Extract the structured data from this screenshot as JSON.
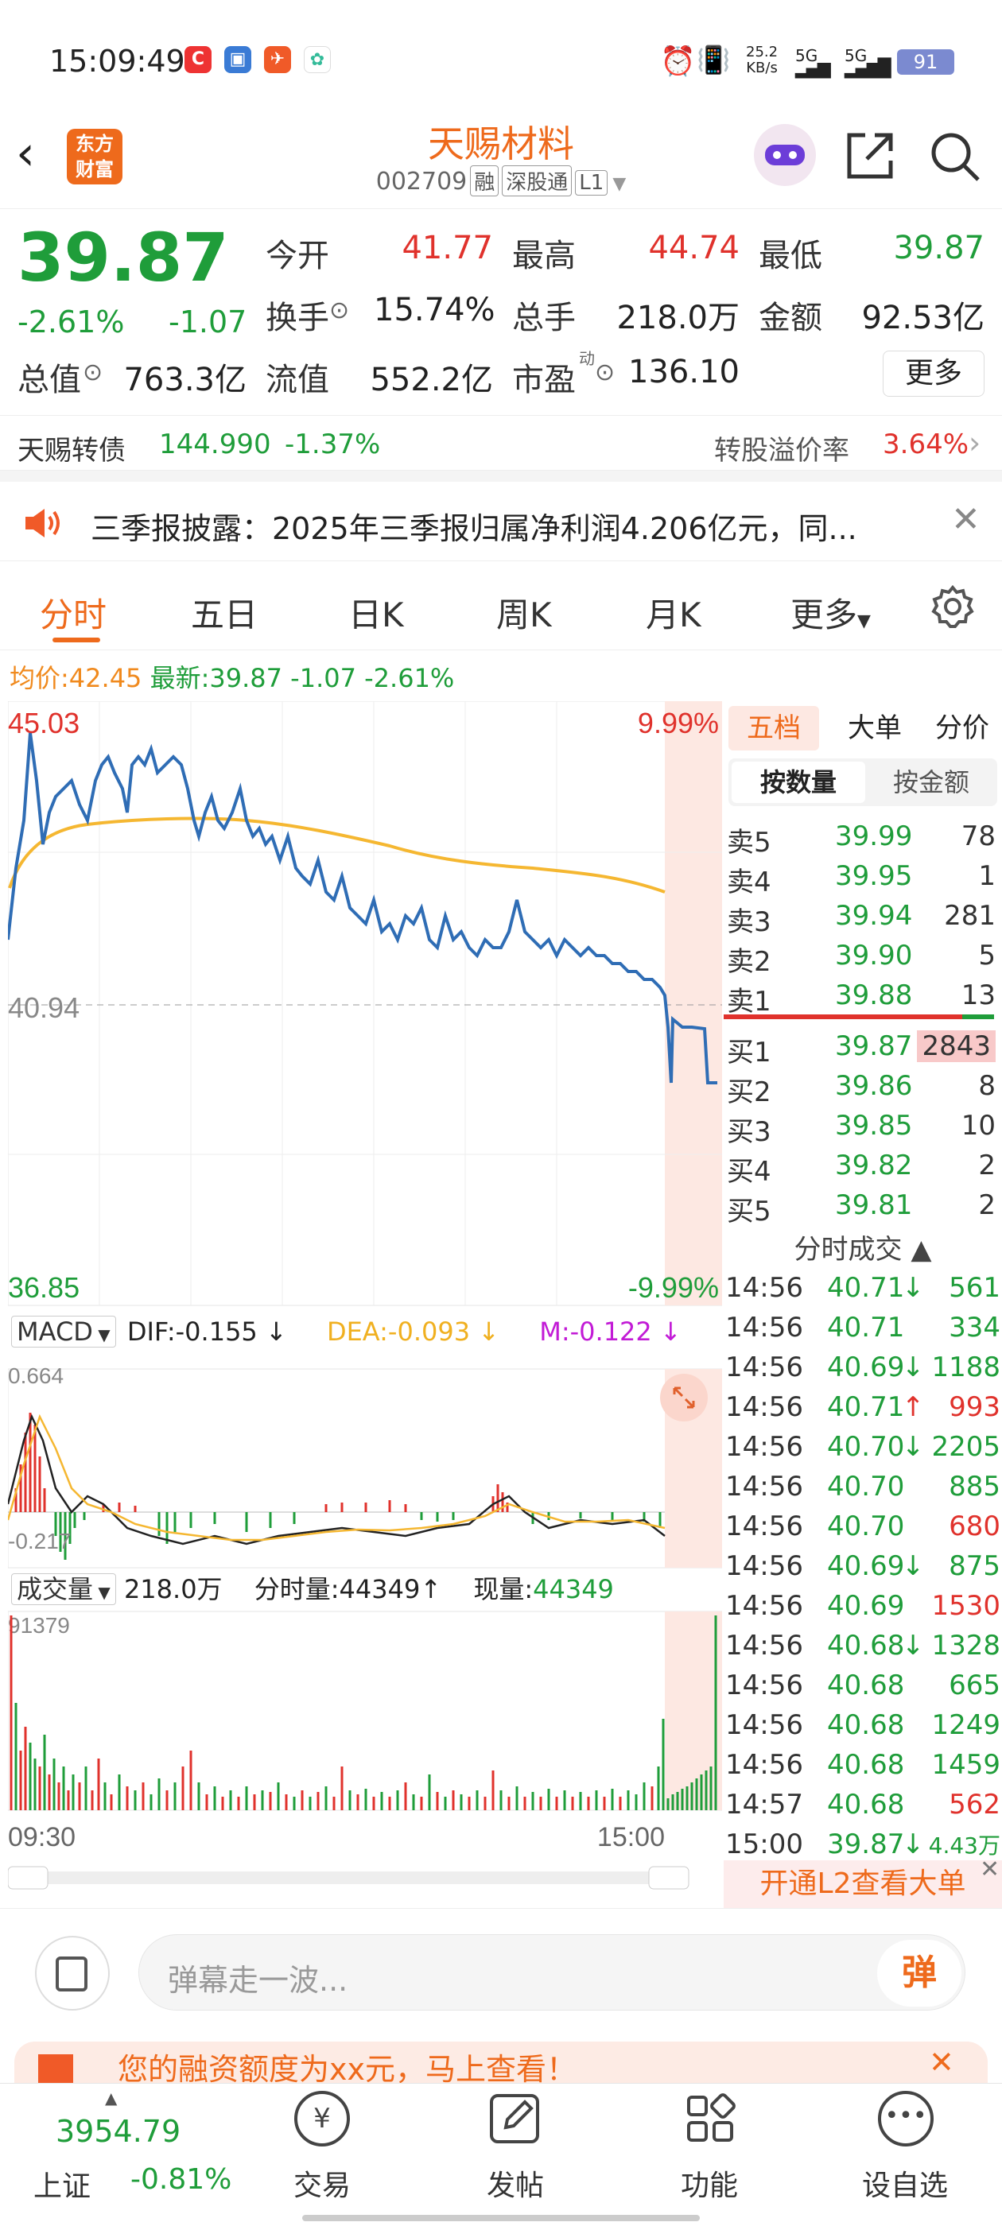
{
  "status_bar": {
    "time": "15:09:49",
    "net_speed": "25.2",
    "net_unit": "KB/s",
    "sig1": "5G",
    "sig2": "5G",
    "battery": "91"
  },
  "header": {
    "back_icon": "back-arrow-icon",
    "brand_line1": "东方",
    "brand_line2": "财富",
    "title": "天赐材料",
    "code": "002709",
    "tags": [
      "融",
      "深股通",
      "L1"
    ]
  },
  "quote": {
    "price": "39.87",
    "change_pct": "-2.61%",
    "change": "-1.07",
    "open_label": "今开",
    "open": "41.77",
    "high_label": "最高",
    "high": "44.74",
    "low_label": "最低",
    "low": "39.87",
    "turnover_label": "换手",
    "turnover": "15.74%",
    "volume_label": "总手",
    "volume": "218.0万",
    "amount_label": "金额",
    "amount": "92.53亿",
    "mktcap_label": "总值",
    "mktcap": "763.3亿",
    "float_label": "流值",
    "float": "552.2亿",
    "pe_label": "市盈",
    "pe_sup": "动",
    "pe": "136.10",
    "more_btn": "更多"
  },
  "bond": {
    "name": "天赐转债",
    "price": "144.990",
    "pct": "-1.37%",
    "premium_label": "转股溢价率",
    "premium": "3.64%"
  },
  "notice": {
    "text": "三季报披露：2025年三季报归属净利润4.206亿元，同..."
  },
  "tabs": [
    "分时",
    "五日",
    "日K",
    "周K",
    "月K",
    "更多"
  ],
  "avg_line": {
    "avg_label": "均价:",
    "avg": "42.45",
    "last_label": "最新:",
    "last": "39.87",
    "chg": "-1.07",
    "pct": "-2.61%"
  },
  "price_chart": {
    "top": "45.03",
    "mid": "40.94",
    "bottom": "36.85",
    "top_pct": "9.99%",
    "bottom_pct": "-9.99%"
  },
  "macd": {
    "label": "MACD",
    "dif": "DIF:-0.155",
    "dea": "DEA:-0.093",
    "m": "M:-0.122",
    "top": "0.664",
    "bottom": "-0.217"
  },
  "volume_panel": {
    "label": "成交量",
    "total": "218.0万",
    "fs_label": "分时量:",
    "fs": "44349",
    "cur_label": "现量:",
    "cur": "44349",
    "max": "91379"
  },
  "time_axis": {
    "start": "09:30",
    "end": "15:00"
  },
  "orderbook": {
    "tabs": [
      "五档",
      "大单",
      "分价"
    ],
    "modes": [
      "按数量",
      "按金额"
    ],
    "sells": [
      {
        "label": "卖5",
        "price": "39.99",
        "qty": "78"
      },
      {
        "label": "卖4",
        "price": "39.95",
        "qty": "1"
      },
      {
        "label": "卖3",
        "price": "39.94",
        "qty": "281"
      },
      {
        "label": "卖2",
        "price": "39.90",
        "qty": "5"
      },
      {
        "label": "卖1",
        "price": "39.88",
        "qty": "13"
      }
    ],
    "buys": [
      {
        "label": "买1",
        "price": "39.87",
        "qty": "2843"
      },
      {
        "label": "买2",
        "price": "39.86",
        "qty": "8"
      },
      {
        "label": "买3",
        "price": "39.85",
        "qty": "10"
      },
      {
        "label": "买4",
        "price": "39.82",
        "qty": "2"
      },
      {
        "label": "买5",
        "price": "39.81",
        "qty": "2"
      }
    ],
    "trades_title": "分时成交",
    "trades": [
      {
        "t": "14:56",
        "p": "40.71",
        "a": "↓",
        "q": "561",
        "c": "green"
      },
      {
        "t": "14:56",
        "p": "40.71",
        "a": "",
        "q": "334",
        "c": "green"
      },
      {
        "t": "14:56",
        "p": "40.69",
        "a": "↓",
        "q": "1188",
        "c": "green"
      },
      {
        "t": "14:56",
        "p": "40.71",
        "a": "↑",
        "q": "993",
        "c": "red"
      },
      {
        "t": "14:56",
        "p": "40.70",
        "a": "↓",
        "q": "2205",
        "c": "green"
      },
      {
        "t": "14:56",
        "p": "40.70",
        "a": "",
        "q": "885",
        "c": "green"
      },
      {
        "t": "14:56",
        "p": "40.70",
        "a": "",
        "q": "680",
        "c": "red"
      },
      {
        "t": "14:56",
        "p": "40.69",
        "a": "↓",
        "q": "875",
        "c": "green"
      },
      {
        "t": "14:56",
        "p": "40.69",
        "a": "",
        "q": "1530",
        "c": "red"
      },
      {
        "t": "14:56",
        "p": "40.68",
        "a": "↓",
        "q": "1328",
        "c": "green"
      },
      {
        "t": "14:56",
        "p": "40.68",
        "a": "",
        "q": "665",
        "c": "green"
      },
      {
        "t": "14:56",
        "p": "40.68",
        "a": "",
        "q": "1249",
        "c": "green"
      },
      {
        "t": "14:56",
        "p": "40.68",
        "a": "",
        "q": "1459",
        "c": "green"
      },
      {
        "t": "14:57",
        "p": "40.68",
        "a": "",
        "q": "562",
        "c": "red"
      },
      {
        "t": "15:00",
        "p": "39.87",
        "a": "↓",
        "q": "4.43万",
        "c": "green"
      }
    ],
    "l2_btn": "开通L2查看大单"
  },
  "comment": {
    "placeholder": "弹幕走一波...",
    "danmu": "弹"
  },
  "promo": {
    "text": "您的融资额度为xx元，马上查看！"
  },
  "bottom_nav": {
    "index_name": "上证",
    "index_value": "3954.79",
    "index_pct": "-0.81%",
    "items": [
      "交易",
      "发帖",
      "功能",
      "设自选"
    ]
  },
  "colors": {
    "up": "#e0322c",
    "down": "#1f9d3a",
    "accent": "#ee6a1c",
    "avg": "#f5b731",
    "price": "#2f6db5"
  }
}
